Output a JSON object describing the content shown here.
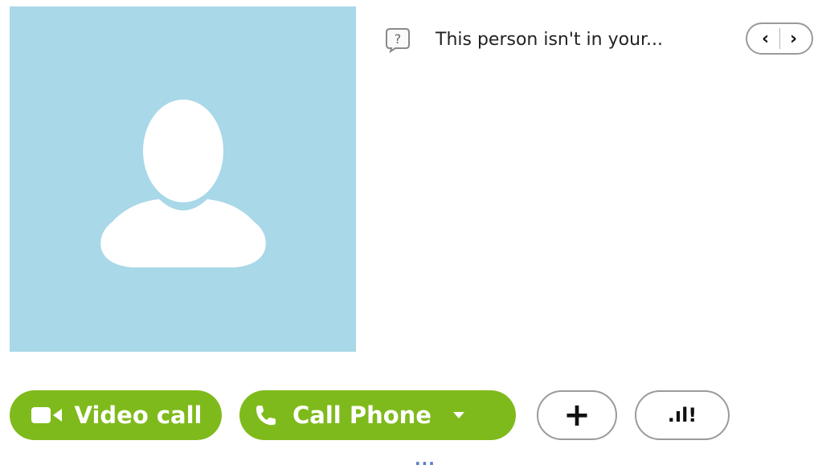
{
  "notice": {
    "text": "This person isn't in your...",
    "icon": "question-bubble-icon"
  },
  "pager": {
    "prev": "‹",
    "next": "›"
  },
  "actions": {
    "video_call": "Video call",
    "call_phone": "Call Phone",
    "add": "+",
    "quality": ".ıl!"
  },
  "more": "...",
  "colors": {
    "avatar_bg": "#a9d8e8",
    "action_green": "#7fba1c",
    "outline_gray": "#9a9a9a",
    "more_blue": "#5a7fc5"
  }
}
